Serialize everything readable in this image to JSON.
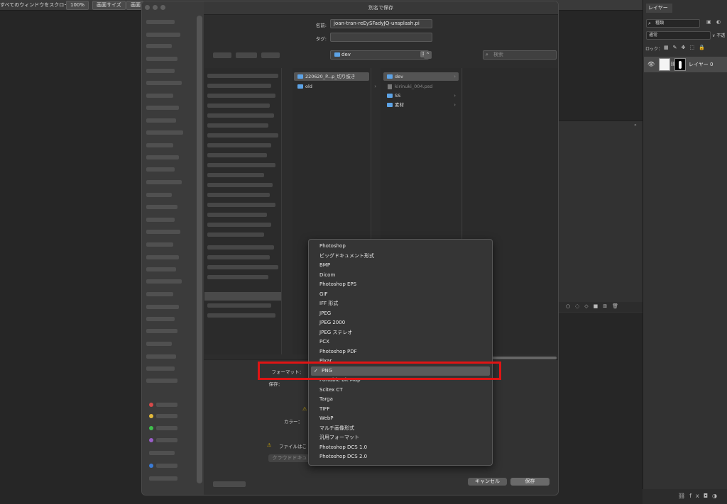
{
  "options_bar": {
    "scroll_all_label": "すべてのウィンドウをスクロール",
    "zoom_label": "100%",
    "fit_screen_label": "画面サイズ",
    "fill_screen_label": "画面"
  },
  "layers_panel": {
    "tab_label": "レイヤー",
    "filter_value": "種類",
    "blend_mode": "通常",
    "opacity_label": "不透",
    "lock_label": "ロック：",
    "layer_name": "レイヤー 0"
  },
  "dialog": {
    "title": "別名で保存",
    "name_label": "名前:",
    "name_value": "joan-tran-reEySFadyJQ-unsplash.pi",
    "tags_label": "タグ:",
    "tags_value": "",
    "location_value": "dev",
    "search_placeholder": "検索",
    "column1": [
      {
        "name": "220620_P...p_切り抜き",
        "selected": true
      },
      {
        "name": "old",
        "selected": false
      }
    ],
    "column2": [
      {
        "name": "dev",
        "type": "folder",
        "selected": true
      },
      {
        "name": "kirinuki_004.psd",
        "type": "file",
        "selected": false
      },
      {
        "name": "SS",
        "type": "folder",
        "selected": false
      },
      {
        "name": "素材",
        "type": "folder",
        "selected": false
      }
    ],
    "format_label": "フォーマット：",
    "save_label": "保存：",
    "color_label": "カラー：",
    "file_warning": "ファイルはこ",
    "cloud_button": "クラウドドキュ",
    "cancel_button": "キャンセル",
    "save_button": "保存"
  },
  "format_menu": {
    "selected": "PNG",
    "items": [
      "Photoshop",
      "ビッグドキュメント形式",
      "BMP",
      "Dicom",
      "Photoshop EPS",
      "GIF",
      "IFF 形式",
      "JPEG",
      "JPEG 2000",
      "JPEG ステレオ",
      "PCX",
      "Photoshop PDF",
      "Pixar",
      "PNG",
      "Portable Bit Map",
      "Scitex CT",
      "Targa",
      "TIFF",
      "WebP",
      "マルチ画像形式",
      "汎用フォーマット",
      "Photoshop DCS 1.0",
      "Photoshop DCS 2.0"
    ]
  },
  "colors": {
    "highlight": "#e01414",
    "folder": "#5da3e6"
  }
}
